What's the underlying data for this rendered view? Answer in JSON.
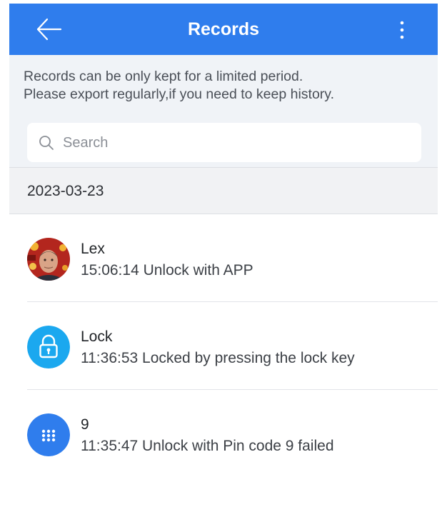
{
  "header": {
    "title": "Records",
    "back_icon": "arrow-left-icon",
    "menu_icon": "more-vertical-icon",
    "color": "#2f7ded"
  },
  "notice": {
    "line1": "Records can be only kept for a limited period.",
    "line2": "Please export regularly,if you need to keep history."
  },
  "search": {
    "placeholder": "Search",
    "value": ""
  },
  "date_group": {
    "date": "2023-03-23"
  },
  "records": [
    {
      "name": "Lex",
      "detail": "15:06:14 Unlock with APP",
      "icon": "user-photo-avatar"
    },
    {
      "name": "Lock",
      "detail": "11:36:53 Locked by pressing the lock key",
      "icon": "padlock-icon",
      "icon_color": "#1ba8ef"
    },
    {
      "name": "9",
      "detail": "11:35:47 Unlock with Pin code 9 failed",
      "icon": "keypad-icon",
      "icon_color": "#2f7ded"
    }
  ]
}
